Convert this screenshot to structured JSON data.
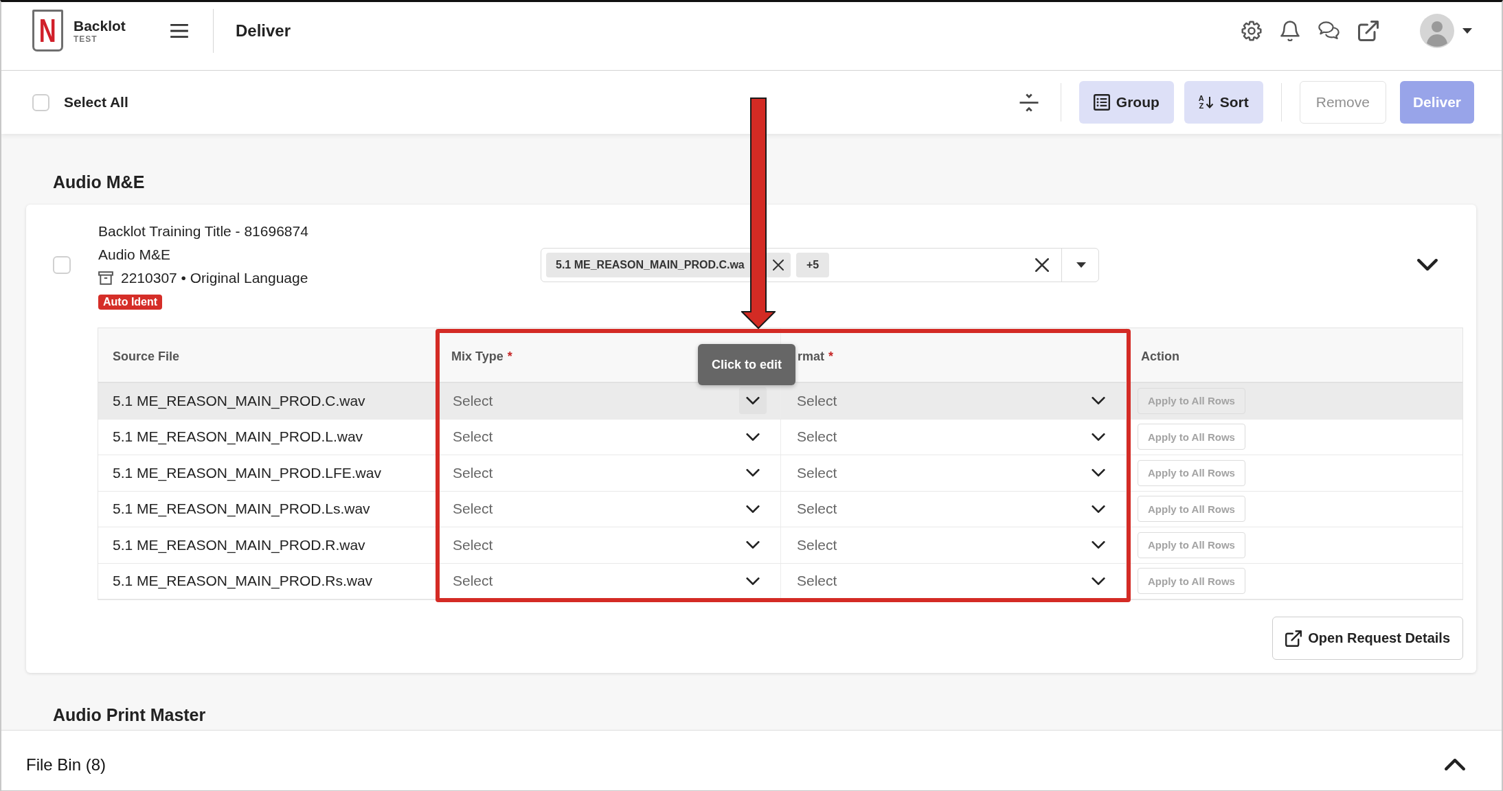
{
  "header": {
    "logo_mark": "N",
    "app_name": "Backlot",
    "environment": "TEST",
    "page_title": "Deliver"
  },
  "toolbar": {
    "select_all": {
      "label": "Select All",
      "checked": false
    },
    "buttons": [
      {
        "kind": "group",
        "label": "Group",
        "disabled": false
      },
      {
        "kind": "sort",
        "label": "Sort",
        "icon_letters": [
          "A",
          "Z"
        ],
        "disabled": false
      },
      {
        "kind": "remove",
        "label": "Remove",
        "disabled": true
      },
      {
        "kind": "deliver",
        "label": "Deliver",
        "disabled": true
      }
    ]
  },
  "sections": [
    {
      "title": "Audio M&E",
      "cards": [
        {
          "checked": false,
          "title": "Backlot Training Title - 81696874",
          "subtitle": "Audio M&E",
          "meta": "2210307 • Original Language",
          "badge": "Auto Ident",
          "file_select": {
            "chips": [
              "5.1 ME_REASON_MAIN_PROD.C.wa"
            ],
            "more": "+5"
          },
          "table": {
            "columns": [
              {
                "label": "Source File"
              },
              {
                "label": "Mix Type",
                "required_mark": "*"
              },
              {
                "label": "rmat",
                "required_mark": "*",
                "tooltip": "Click to edit"
              },
              {
                "label": "Action"
              }
            ],
            "rows": [
              {
                "source_file": "5.1 ME_REASON_MAIN_PROD.C.wav",
                "mix_type": {
                  "placeholder": "Select",
                  "hovered": true
                },
                "format": {
                  "placeholder": "Select",
                  "hovered": false
                },
                "action": {
                  "label": "Apply to All Rows",
                  "disabled": true
                },
                "highlighted": true
              },
              {
                "source_file": "5.1 ME_REASON_MAIN_PROD.L.wav",
                "mix_type": {
                  "placeholder": "Select",
                  "hovered": false
                },
                "format": {
                  "placeholder": "Select",
                  "hovered": false
                },
                "action": {
                  "label": "Apply to All Rows",
                  "disabled": true
                },
                "highlighted": false
              },
              {
                "source_file": "5.1 ME_REASON_MAIN_PROD.LFE.wav",
                "mix_type": {
                  "placeholder": "Select",
                  "hovered": false
                },
                "format": {
                  "placeholder": "Select",
                  "hovered": false
                },
                "action": {
                  "label": "Apply to All Rows",
                  "disabled": true
                },
                "highlighted": false
              },
              {
                "source_file": "5.1 ME_REASON_MAIN_PROD.Ls.wav",
                "mix_type": {
                  "placeholder": "Select",
                  "hovered": false
                },
                "format": {
                  "placeholder": "Select",
                  "hovered": false
                },
                "action": {
                  "label": "Apply to All Rows",
                  "disabled": true
                },
                "highlighted": false
              },
              {
                "source_file": "5.1 ME_REASON_MAIN_PROD.R.wav",
                "mix_type": {
                  "placeholder": "Select",
                  "hovered": false
                },
                "format": {
                  "placeholder": "Select",
                  "hovered": false
                },
                "action": {
                  "label": "Apply to All Rows",
                  "disabled": true
                },
                "highlighted": false
              },
              {
                "source_file": "5.1 ME_REASON_MAIN_PROD.Rs.wav",
                "mix_type": {
                  "placeholder": "Select",
                  "hovered": false
                },
                "format": {
                  "placeholder": "Select",
                  "hovered": false
                },
                "action": {
                  "label": "Apply to All Rows",
                  "disabled": true
                },
                "highlighted": false
              }
            ]
          },
          "details_button": "Open Request Details"
        }
      ]
    },
    {
      "title": "Audio Print Master"
    }
  ],
  "file_bin": {
    "label": "File Bin (8)"
  }
}
